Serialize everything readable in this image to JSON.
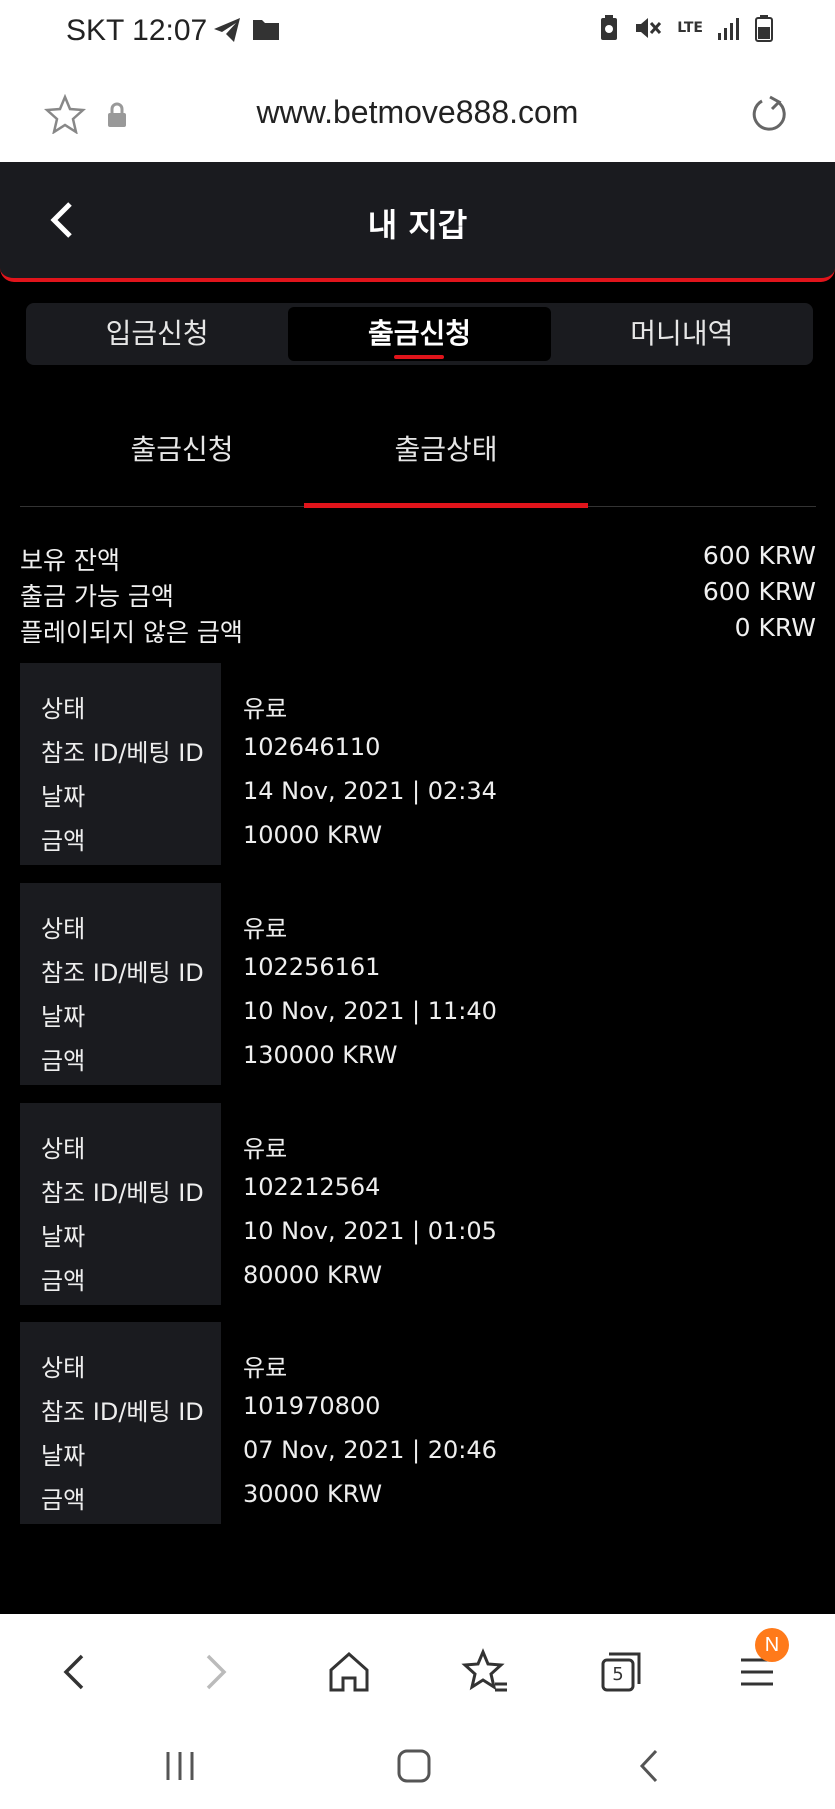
{
  "status_bar": {
    "carrier_time": "SKT 12:07",
    "network": "LTE"
  },
  "browser": {
    "url": "www.betmove888.com",
    "tabs_count": "5",
    "badge": "N"
  },
  "header": {
    "title": "내 지갑"
  },
  "main_tabs": [
    {
      "label": "입금신청"
    },
    {
      "label": "출금신청"
    },
    {
      "label": "머니내역"
    }
  ],
  "sub_tabs": [
    {
      "label": "출금신청"
    },
    {
      "label": "출금상태"
    }
  ],
  "balance": [
    {
      "label": "보유 잔액",
      "value": "600 KRW"
    },
    {
      "label": "출금 가능 금액",
      "value": "600 KRW"
    },
    {
      "label": "플레이되지 않은 금액",
      "value": "0 KRW"
    }
  ],
  "labels": {
    "status": "상태",
    "ref_id": "참조 ID/베팅 ID",
    "date": "날짜",
    "amount": "금액"
  },
  "records": [
    {
      "status": "유료",
      "ref_id": "102646110",
      "date": "14 Nov, 2021 | 02:34",
      "amount": "10000 KRW"
    },
    {
      "status": "유료",
      "ref_id": "102256161",
      "date": "10 Nov, 2021 | 11:40",
      "amount": "130000 KRW"
    },
    {
      "status": "유료",
      "ref_id": "102212564",
      "date": "10 Nov, 2021 | 01:05",
      "amount": "80000 KRW"
    },
    {
      "status": "유료",
      "ref_id": "101970800",
      "date": "07 Nov, 2021 | 20:46",
      "amount": "30000 KRW"
    }
  ],
  "colors": {
    "accent": "#e0141b",
    "panel": "#1a1b1f",
    "badge": "#ff7a1a"
  }
}
